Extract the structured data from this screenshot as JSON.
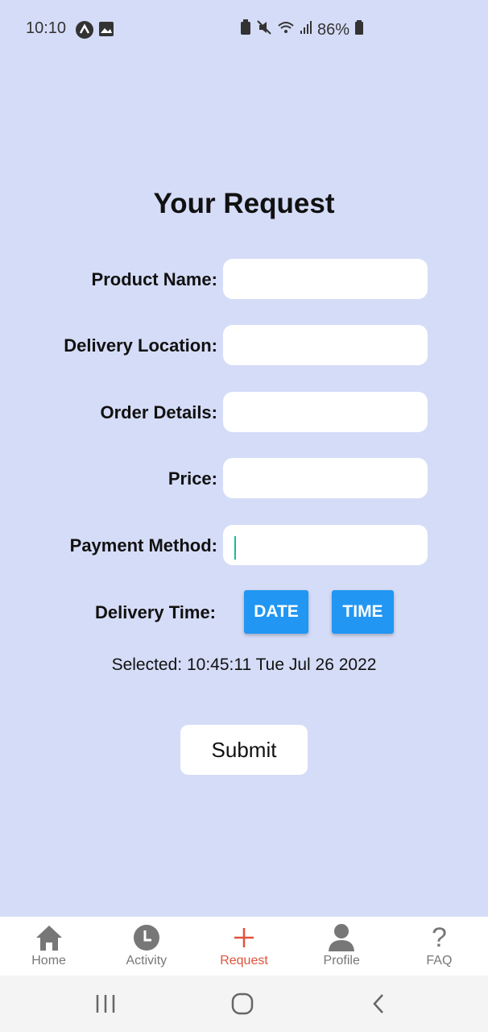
{
  "status_bar": {
    "time": "10:10",
    "battery": "86%"
  },
  "title": "Your Request",
  "fields": [
    {
      "label": "Product Name:",
      "value": ""
    },
    {
      "label": "Delivery Location:",
      "value": ""
    },
    {
      "label": "Order Details:",
      "value": ""
    },
    {
      "label": "Price:",
      "value": ""
    },
    {
      "label": "Payment Method:",
      "value": ""
    }
  ],
  "delivery": {
    "label": "Delivery Time:",
    "date_button": "DATE",
    "time_button": "TIME",
    "selected": "Selected: 10:45:11 Tue Jul 26 2022"
  },
  "submit_label": "Submit",
  "colors": {
    "background": "#d5dcf7",
    "button": "#2196f3",
    "active_tab": "#e0533a"
  },
  "tabs": [
    {
      "label": "Home",
      "icon": "home-icon"
    },
    {
      "label": "Activity",
      "icon": "clock-icon"
    },
    {
      "label": "Request",
      "icon": "plus-icon",
      "active": true
    },
    {
      "label": "Profile",
      "icon": "person-icon"
    },
    {
      "label": "FAQ",
      "icon": "question-icon"
    }
  ]
}
